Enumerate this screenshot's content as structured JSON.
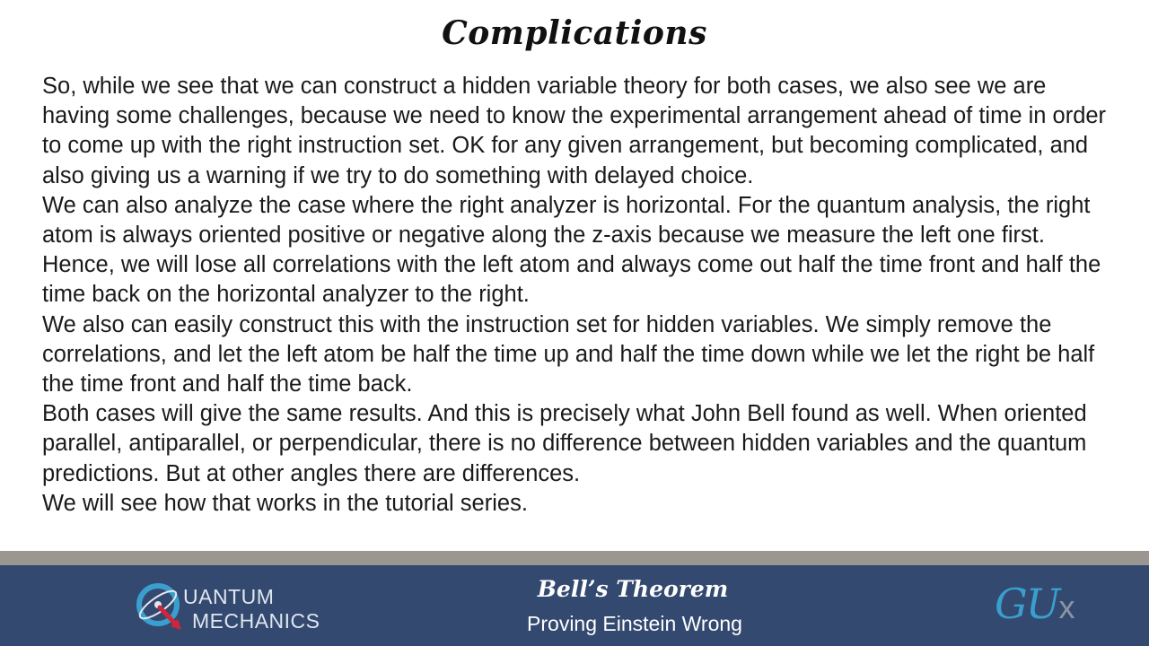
{
  "slide": {
    "title": "Complications",
    "paragraphs": [
      "So, while we see that we can construct a hidden variable theory for both cases, we also see we are having some challenges, because we need to know the experimental arrangement ahead of time in order to come up with the right instruction set. OK for any given arrangement, but becoming complicated, and also giving us a warning if we try to do something with delayed choice.",
      "We can also analyze the case where the right analyzer is horizontal. For the quantum analysis, the right atom is always oriented positive or negative along the z-axis because we measure the left one first. Hence, we will lose all correlations with the left atom and always come out half the time front and half the time back on the horizontal analyzer to the right.",
      "We also can easily construct this with the instruction set for hidden variables. We simply remove the correlations, and let the left atom be half the time up and half the time down while we let the right be half the time front and half the time back.",
      "Both cases will give the same results. And this is precisely what John Bell found as well. When oriented parallel, antiparallel, or perpendicular, there is no difference between hidden variables and the quantum predictions. But at other angles there are differences.",
      "We will see how that works in the tutorial series."
    ]
  },
  "footer": {
    "logo_line1": "UANTUM",
    "logo_line2": "MECHANICS",
    "logo_icon": "quantum-q-atom-icon",
    "course_title": "Bell’s Theorem",
    "course_subtitle": "Proving Einstein Wrong",
    "brand_main": "GU",
    "brand_suffix": "x"
  },
  "colors": {
    "footer_bg": "#33496f",
    "strip": "#9b9690",
    "brand_blue": "#3a9fcf",
    "arrow_red": "#d0263a"
  }
}
